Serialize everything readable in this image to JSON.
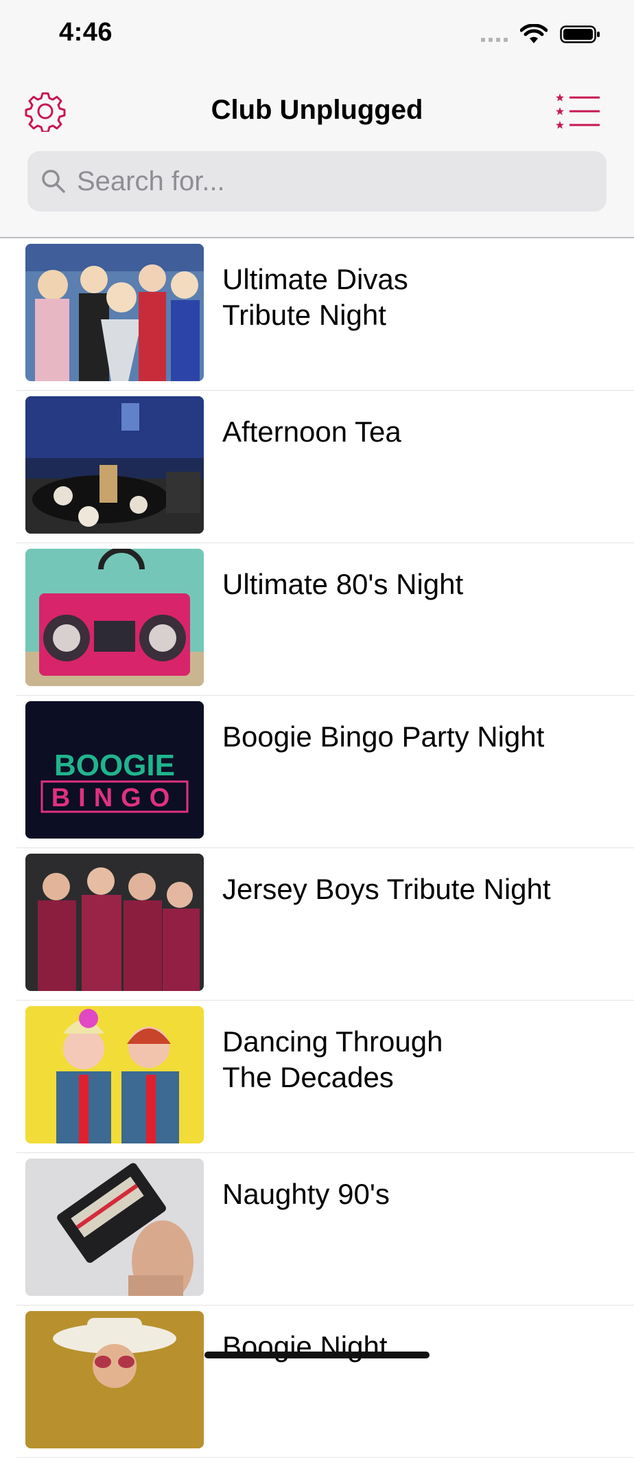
{
  "status_bar": {
    "time": "4:46"
  },
  "nav": {
    "title": "Club Unplugged",
    "settings_icon": "gear-icon",
    "favorites_icon": "starred-list-icon",
    "accent": "#c8174f"
  },
  "search": {
    "placeholder": "Search for..."
  },
  "events": [
    {
      "title": "Ultimate Divas\nTribute Night"
    },
    {
      "title": "Afternoon Tea"
    },
    {
      "title": "Ultimate 80's Night"
    },
    {
      "title": "Boogie Bingo Party Night",
      "logo_line1": "BOOGIE",
      "logo_line2": "BINGO"
    },
    {
      "title": "Jersey Boys Tribute Night"
    },
    {
      "title": "Dancing Through\nThe Decades"
    },
    {
      "title": "Naughty 90's"
    },
    {
      "title": "Boogie Night"
    }
  ]
}
